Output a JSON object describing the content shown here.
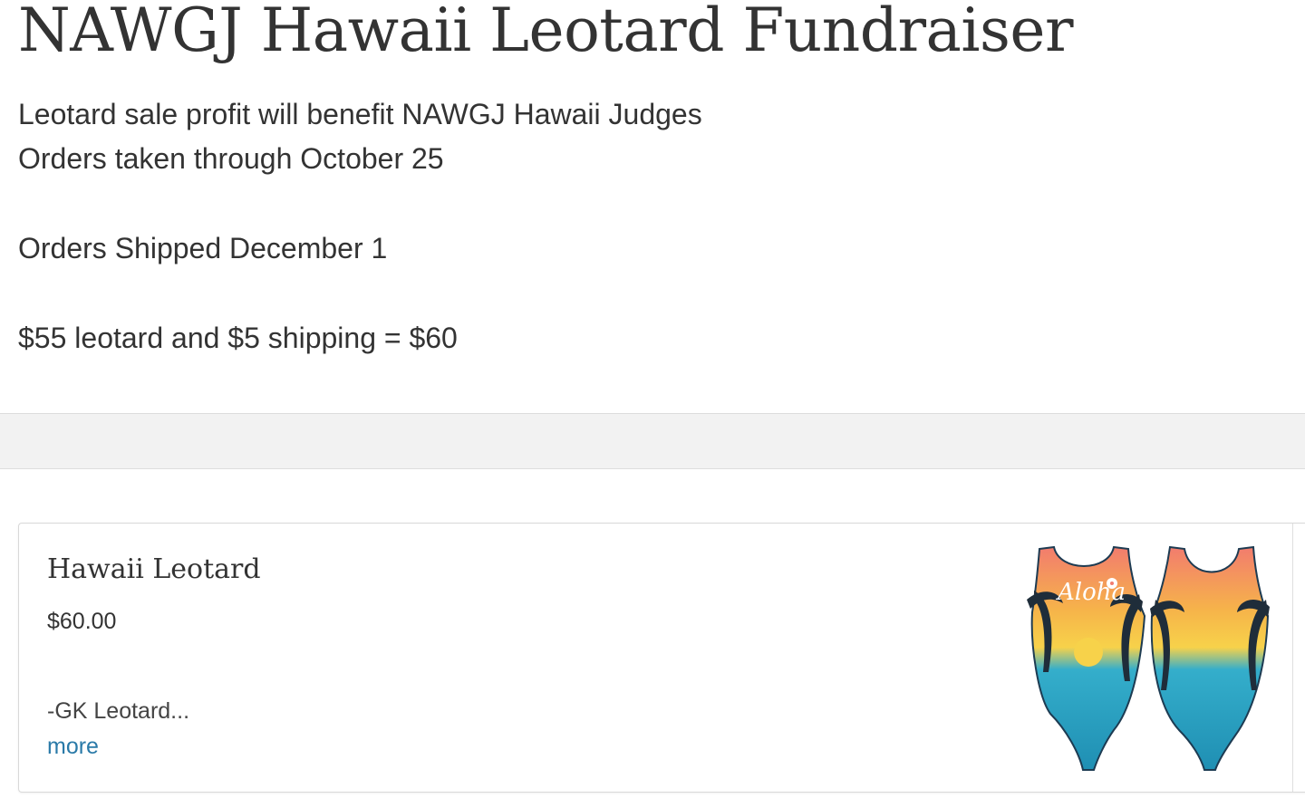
{
  "page": {
    "title": "NAWGJ Hawaii Leotard Fundraiser",
    "description_lines": [
      "Leotard sale profit will benefit NAWGJ Hawaii Judges",
      "Orders taken through October 25",
      "Orders Shipped December 1",
      "$55 leotard and $5 shipping = $60"
    ]
  },
  "product": {
    "name": "Hawaii Leotard",
    "price": "$60.00",
    "description": "-GK Leotard...",
    "more_label": "more",
    "image": {
      "print_text": "Aloha",
      "colors": {
        "sky_top": "#f27c6e",
        "sky_mid": "#f6b34a",
        "sun": "#f7d24a",
        "sea": "#34aecb",
        "sea_deep": "#1f8fb3",
        "palm": "#1f2d3a",
        "outline": "#1d3b52"
      }
    }
  },
  "colors": {
    "text": "#333333",
    "link": "#2a7aa8",
    "band": "#f2f2f2",
    "border": "#d9d9d9"
  }
}
